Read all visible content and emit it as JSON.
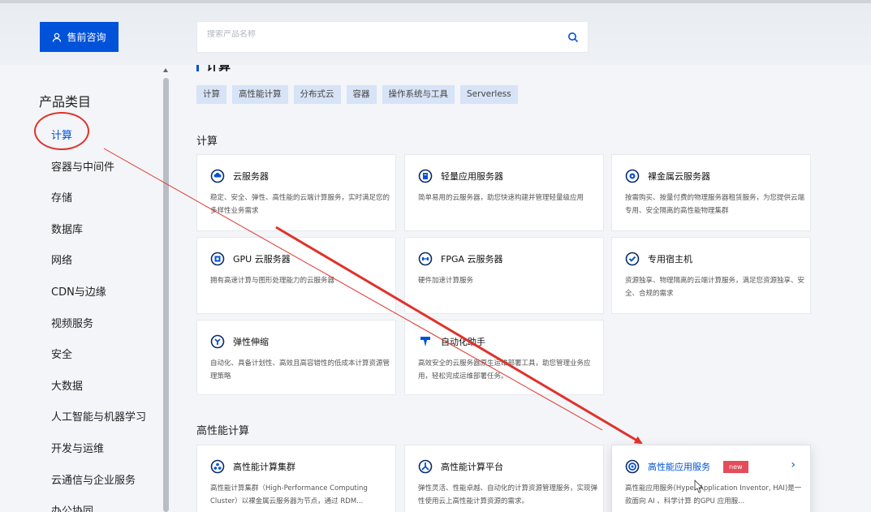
{
  "header": {
    "consult_label": "售前咨询",
    "search_placeholder": "搜索产品名称"
  },
  "sidebar": {
    "title": "产品类目",
    "items": [
      "计算",
      "容器与中间件",
      "存储",
      "数据库",
      "网络",
      "CDN与边缘",
      "视频服务",
      "安全",
      "大数据",
      "人工智能与机器学习",
      "开发与运维",
      "云通信与企业服务",
      "办公协同"
    ]
  },
  "main": {
    "section_title": "计算",
    "tags": [
      "计算",
      "高性能计算",
      "分布式云",
      "容器",
      "操作系统与工具",
      "Serverless"
    ],
    "groups": [
      {
        "title": "计算",
        "cards": [
          {
            "title": "云服务器",
            "desc": "稳定、安全、弹性、高性能的云端计算服务，实时满足您的多样性业务需求",
            "icon": "cloud-server-icon"
          },
          {
            "title": "轻量应用服务器",
            "desc": "简单易用的云服务器，助您快速构建并管理轻量级应用",
            "icon": "lighthouse-icon"
          },
          {
            "title": "裸金属云服务器",
            "desc": "按需购买、按量付费的物理服务器租赁服务，为您提供云端专用、安全隔离的高性能物理集群",
            "icon": "bare-metal-icon"
          },
          {
            "title": "GPU 云服务器",
            "desc": "拥有高速计算与图形处理能力的云服务器",
            "icon": "gpu-icon"
          },
          {
            "title": "FPGA 云服务器",
            "desc": "硬件加速计算服务",
            "icon": "fpga-icon"
          },
          {
            "title": "专用宿主机",
            "desc": "资源独享、物理隔离的云端计算服务，满足您资源独享、安全、合规的需求",
            "icon": "dedicated-host-icon"
          },
          {
            "title": "弹性伸缩",
            "desc": "自动化、具备计划性、高效且高容错性的低成本计算资源管理策略",
            "icon": "auto-scaling-icon"
          },
          {
            "title": "自动化助手",
            "desc": "高效安全的云服务器原生运维部署工具，助您管理业务应用，轻松完成运维部署任务。",
            "icon": "automation-assistant-icon"
          }
        ]
      },
      {
        "title": "高性能计算",
        "cards": [
          {
            "title": "高性能计算集群",
            "desc": "高性能计算集群（High-Performance Computing Cluster）以裸金属云服务器为节点，通过 RDM...",
            "icon": "hpc-cluster-icon"
          },
          {
            "title": "高性能计算平台",
            "desc": "弹性灵活、性能卓越、自动化的计算资源管理服务，实现弹性使用云上高性能计算资源的需求。",
            "icon": "hpc-platform-icon"
          },
          {
            "title": "高性能应用服务",
            "desc": "高性能应用服务(Hyper Application Inventor, HAI)是一款面向 AI 、科学计算 的GPU 应用服...",
            "icon": "hai-icon",
            "badge": "new",
            "chevron": "›"
          }
        ]
      }
    ]
  },
  "colors": {
    "brand": "#0052d9",
    "annotation": "#e0322a",
    "badge": "#e34d59"
  }
}
